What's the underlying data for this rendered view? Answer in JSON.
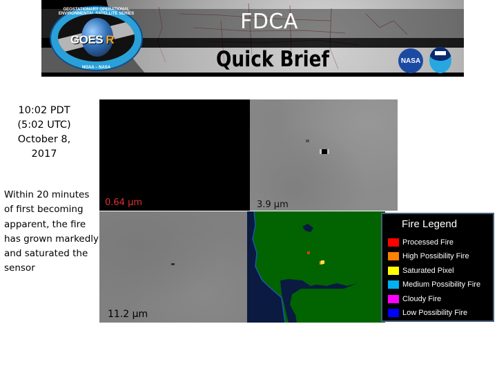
{
  "header": {
    "title": "FDCA",
    "subtitle": "Quick Brief",
    "logos": {
      "goes": {
        "main": "GOES",
        "accent": "R",
        "ring_top": "GEOSTATIONARY OPERATIONAL ENVIRONMENTAL SATELLITE SERIES",
        "ring_bottom": "NOAA – NASA"
      },
      "nasa": "NASA",
      "noaa": "noaa-logo"
    }
  },
  "left": {
    "date_lines": [
      "10:02 PDT",
      "(5:02 UTC)",
      "October 8,",
      "2017"
    ],
    "description": "Within 20 minutes of first becoming apparent, the fire has grown markedly and saturated the sensor"
  },
  "panels": {
    "visible": {
      "label": "0.64 µm"
    },
    "shortwave": {
      "label": "3.9 µm"
    },
    "longwave": {
      "label": "11.2 µm"
    },
    "fdca": {
      "label": ""
    }
  },
  "legend": {
    "title": "Fire Legend",
    "items": [
      {
        "label": "Processed Fire",
        "color": "#ff0000"
      },
      {
        "label": "High Possibility Fire",
        "color": "#ff8000"
      },
      {
        "label": "Saturated Pixel",
        "color": "#ffff00"
      },
      {
        "label": "Medium Possibility Fire",
        "color": "#00b0f0"
      },
      {
        "label": "Cloudy Fire",
        "color": "#ff00ff"
      },
      {
        "label": "Low Possibility Fire",
        "color": "#0000ff"
      }
    ]
  }
}
